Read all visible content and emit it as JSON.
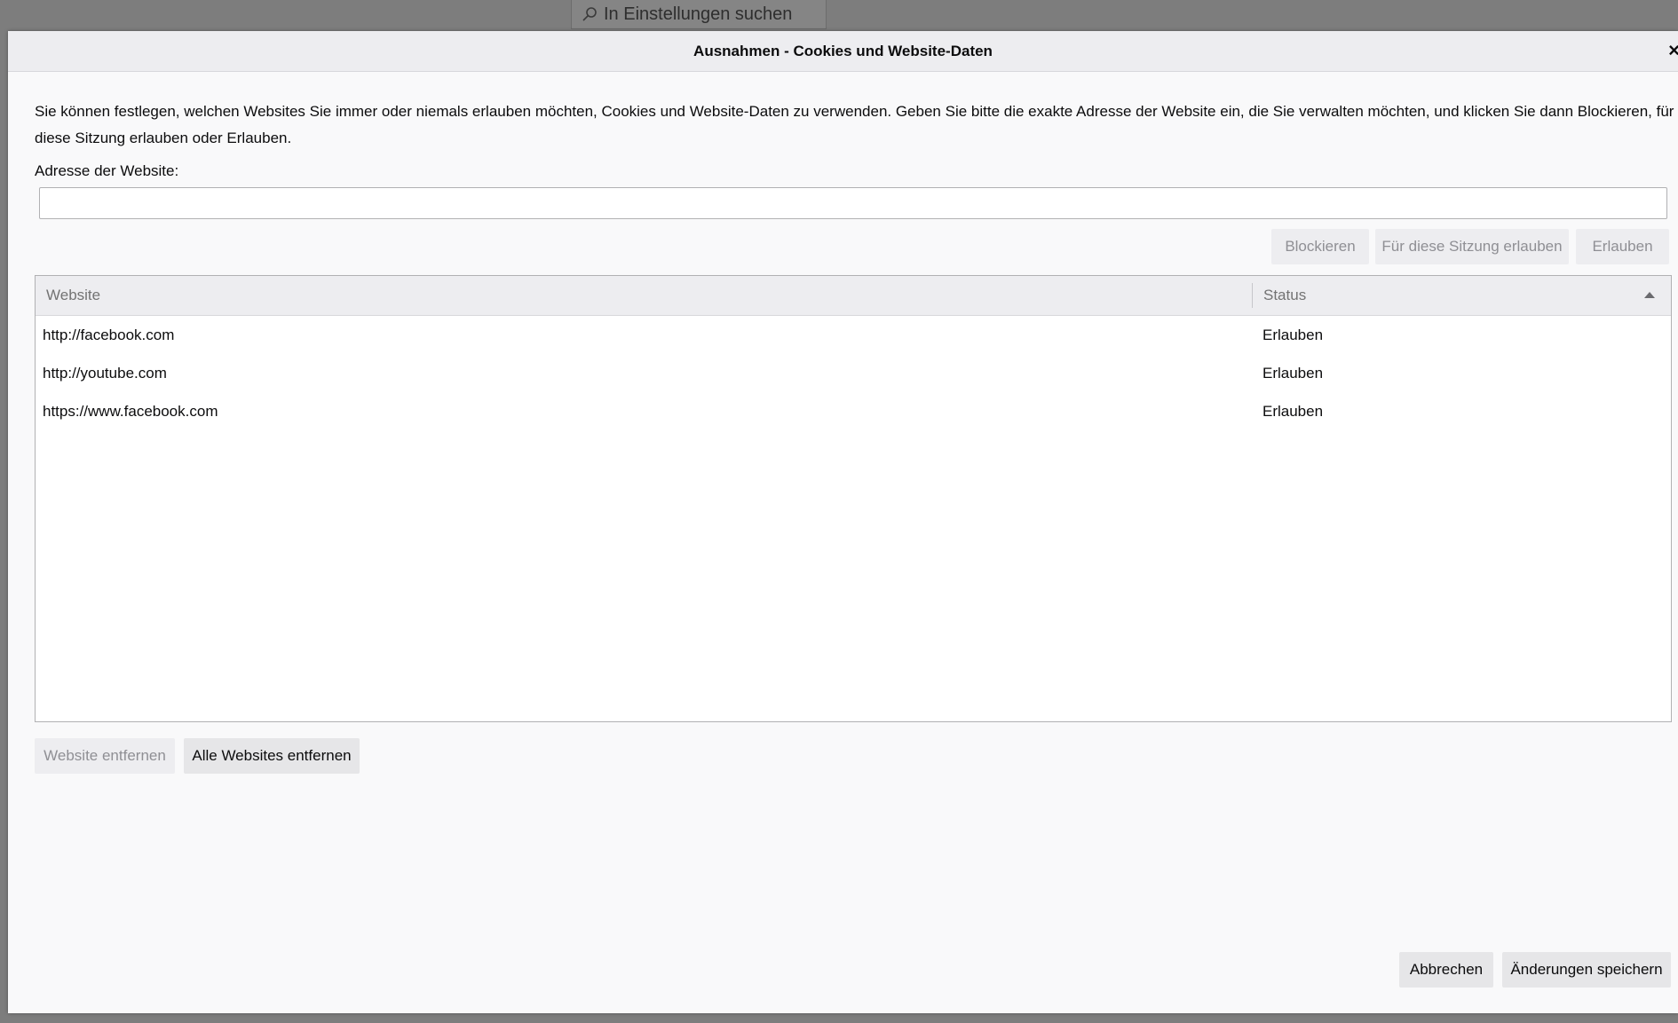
{
  "background": {
    "search_placeholder": "In Einstellungen suchen"
  },
  "dialog": {
    "title": "Ausnahmen - Cookies und Website-Daten",
    "close_glyph": "×",
    "description": "Sie können festlegen, welchen Websites Sie immer oder niemals erlauben möchten, Cookies und Website-Daten zu verwenden. Geben Sie bitte die exakte Adresse der Website ein, die Sie verwalten möchten, und klicken Sie dann Blockieren, für diese Sitzung erlauben oder Erlauben.",
    "address_label": "Adresse der Website:",
    "address_value": "",
    "buttons": {
      "block": "Blockieren",
      "allow_session": "Für diese Sitzung erlauben",
      "allow": "Erlauben",
      "remove_site": "Website entfernen",
      "remove_all": "Alle Websites entfernen",
      "cancel": "Abbrechen",
      "save": "Änderungen speichern"
    },
    "table": {
      "headers": [
        "Website",
        "Status"
      ],
      "rows": [
        {
          "site": "http://facebook.com",
          "status": "Erlauben"
        },
        {
          "site": "http://youtube.com",
          "status": "Erlauben"
        },
        {
          "site": "https://www.facebook.com",
          "status": "Erlauben"
        }
      ]
    }
  },
  "colors": {
    "overlay": "#7d7d7d",
    "dialog_bg": "#f9f9fa",
    "header_bg": "#ededf0",
    "button_bg": "#e6e6e8",
    "disabled_text": "#8f8f94"
  }
}
